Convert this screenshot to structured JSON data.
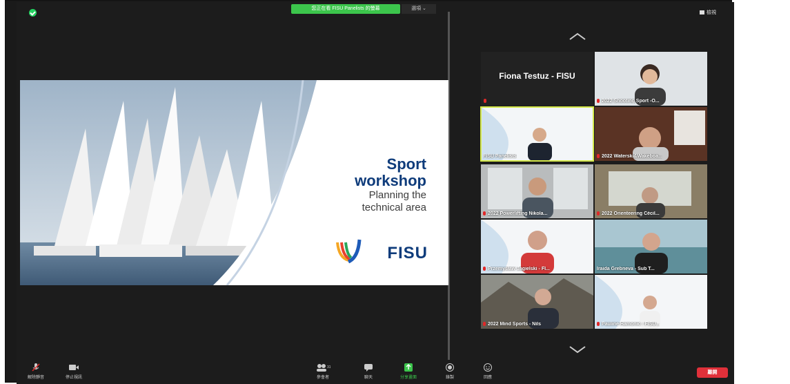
{
  "top_bar": {
    "share_banner": "您正在看 FISU Panelists 的螢幕",
    "options_label": "選項 ⌄",
    "view_label": "檢視"
  },
  "slide": {
    "title_line1": "Sport",
    "title_line2": "workshop",
    "subtitle_line1": "Planning the",
    "subtitle_line2": "technical area",
    "logo_text": "FISU"
  },
  "gallery": {
    "tiles": [
      {
        "label": "Fiona Testuz - FISU",
        "type": "name"
      },
      {
        "label": "2022 Shooting Sport -O...",
        "type": "video"
      },
      {
        "label": "FISU Panelists",
        "type": "video"
      },
      {
        "label": "2022 Waterski&Wakeboa...",
        "type": "video"
      },
      {
        "label": "2022 Powerlifting Nikola...",
        "type": "video"
      },
      {
        "label": "2022 Orienteering Cécil...",
        "type": "video"
      },
      {
        "label": "Przemysław Jagielski - FI...",
        "type": "video"
      },
      {
        "label": "Iraida Grebneva - Sub T...",
        "type": "video"
      },
      {
        "label": "2022 Mind Sports - Nils",
        "type": "video"
      },
      {
        "label": "Pauline Hamonic - FISU...",
        "type": "video"
      }
    ]
  },
  "toolbar": {
    "unmute_label": "解除靜音",
    "stop_video_label": "停止視訊",
    "participants_label": "參會者",
    "participants_count": "31",
    "chat_label": "聊天",
    "share_label": "分享畫面",
    "record_label": "錄製",
    "reactions_label": "回應",
    "end_label": "離開"
  },
  "colors": {
    "accent_green": "#3cc54c",
    "end_red": "#e0303a",
    "active_speaker": "#d5e84a",
    "brand_blue": "#0f3c7b"
  }
}
